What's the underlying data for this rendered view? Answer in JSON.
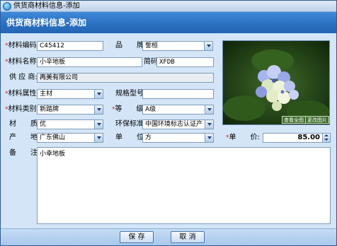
{
  "window": {
    "title": "供货商材料信息-添加"
  },
  "banner": {
    "title": "供货商材料信息-添加"
  },
  "form": {
    "code": {
      "label": "材料编码:",
      "value": "C45412"
    },
    "brand": {
      "label": "品　　牌:",
      "value": "誓桓"
    },
    "name": {
      "label": "材料名称:",
      "value": "小辛地板"
    },
    "shortcode": {
      "label": "简码",
      "value": "XFDB"
    },
    "supplier": {
      "label": "供 应 商:",
      "value": "再美有限公司"
    },
    "attribute": {
      "label": "材料属性:",
      "value": "主材"
    },
    "spec": {
      "label": "规格型号:",
      "value": ""
    },
    "category": {
      "label": "材料类别:",
      "value": "新踏牌"
    },
    "grade": {
      "label": "等　　级:",
      "value": "A级"
    },
    "material": {
      "label": "材　　质:",
      "value": "优"
    },
    "eco": {
      "label": "环保标准:",
      "value": "中国环境标志认证产"
    },
    "origin": {
      "label": "产　　地:",
      "value": "广东佛山"
    },
    "unit": {
      "label": "单　　位:",
      "value": "方"
    },
    "price": {
      "label": "单　　价:",
      "value": "85.00"
    },
    "remark": {
      "label": "备　　注:",
      "value": "小幸地板"
    }
  },
  "photo": {
    "view_label": "查看全图",
    "change_label": "更改图片"
  },
  "buttons": {
    "save": "保 存",
    "cancel": "取 消"
  },
  "colors": {
    "banner": "#2a6fc0",
    "panel": "#d3e5f7",
    "required": "#e02020"
  }
}
